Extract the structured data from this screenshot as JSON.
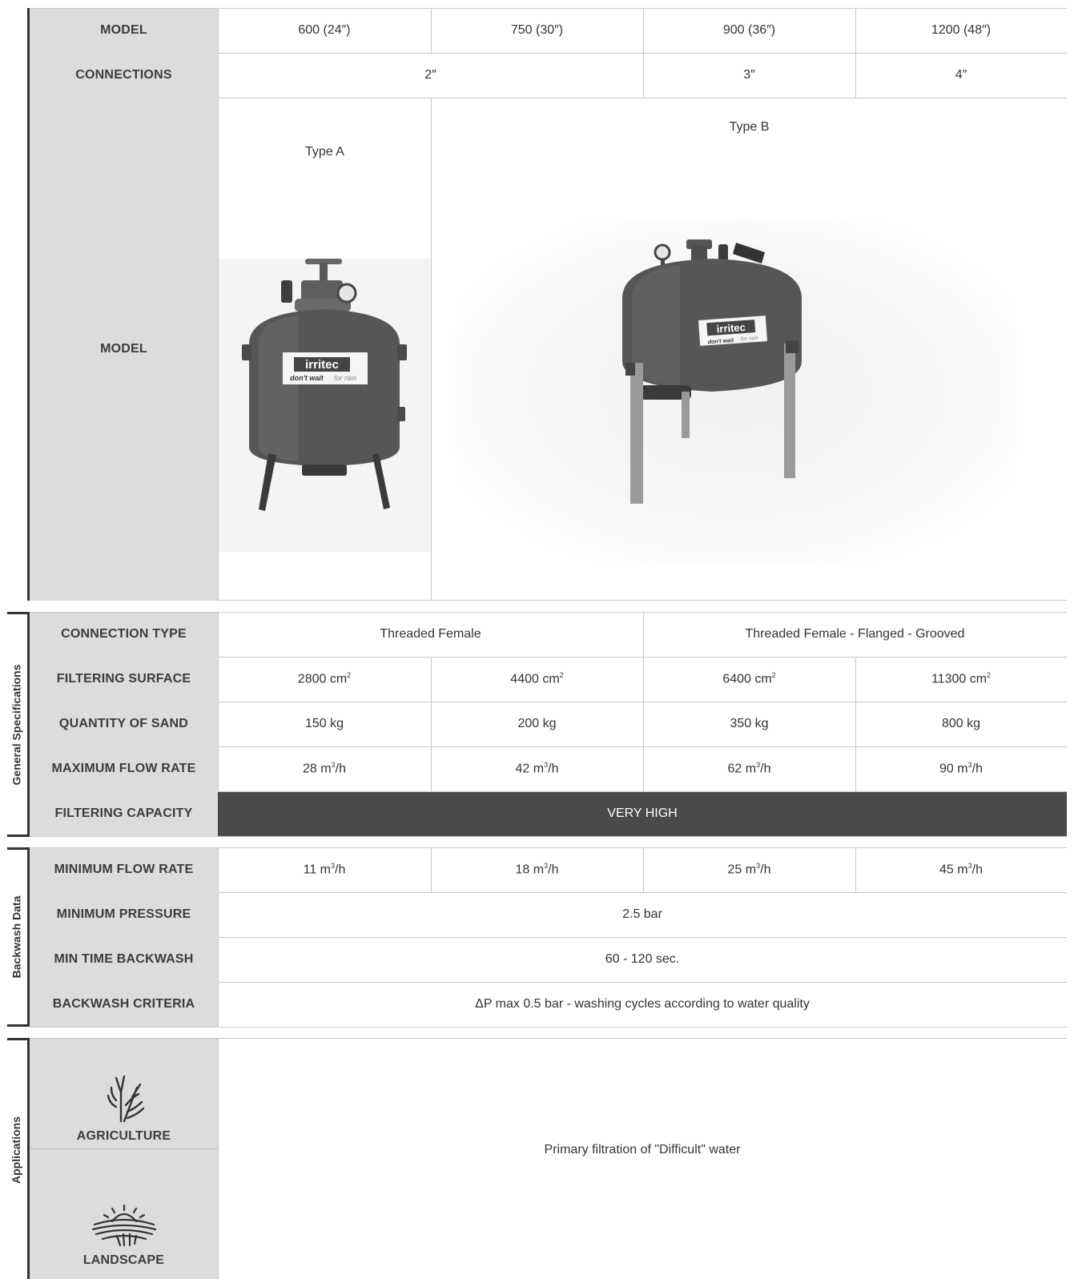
{
  "top": {
    "model_label": "MODEL",
    "models": [
      "600 (24″)",
      "750 (30″)",
      "900 (36″)",
      "1200 (48″)"
    ],
    "connections_label": "CONNECTIONS",
    "connections": [
      "2″",
      "3″",
      "4″"
    ],
    "image_row_label": "MODEL",
    "type_a": "Type A",
    "type_b": "Type B",
    "brand": "irritec",
    "tagline_bold": "don't wait",
    "tagline_light": "for rain"
  },
  "general": {
    "section_label": "General Specifications",
    "connection_type_label": "CONNECTION TYPE",
    "connection_type": [
      "Threaded Female",
      "Threaded Female - Flanged - Grooved"
    ],
    "filtering_surface_label": "FILTERING SURFACE",
    "filtering_surface": [
      "2800 cm",
      "4400 cm",
      "6400 cm",
      "11300 cm"
    ],
    "filtering_surface_unit_sup": "2",
    "quantity_sand_label": "QUANTITY OF SAND",
    "quantity_sand": [
      "150 kg",
      "200 kg",
      "350 kg",
      "800 kg"
    ],
    "max_flow_label": "MAXIMUM FLOW RATE",
    "max_flow": [
      "28 m",
      "42 m",
      "62 m",
      "90 m"
    ],
    "flow_sup": "3",
    "flow_suffix": "/h",
    "filtering_capacity_label": "FILTERING CAPACITY",
    "filtering_capacity": "VERY HIGH"
  },
  "backwash": {
    "section_label": "Backwash Data",
    "min_flow_label": "MINIMUM FLOW RATE",
    "min_flow": [
      "11 m",
      "18 m",
      "25 m",
      "45 m"
    ],
    "min_pressure_label": "MINIMUM PRESSURE",
    "min_pressure": "2.5 bar",
    "min_time_label": "MIN TIME BACKWASH",
    "min_time": "60 - 120 sec.",
    "criteria_label": "BACKWASH CRITERIA",
    "criteria": "ΔP max 0.5 bar - washing cycles according to water quality"
  },
  "applications": {
    "section_label": "Applications",
    "agriculture": "AGRICULTURE",
    "landscape": "LANDSCAPE",
    "description": "Primary filtration of \"Difficult\" water"
  },
  "colors": {
    "header_bg": "#dcdcdc",
    "dark_band": "#4a4a4a",
    "tank": "#565656"
  }
}
